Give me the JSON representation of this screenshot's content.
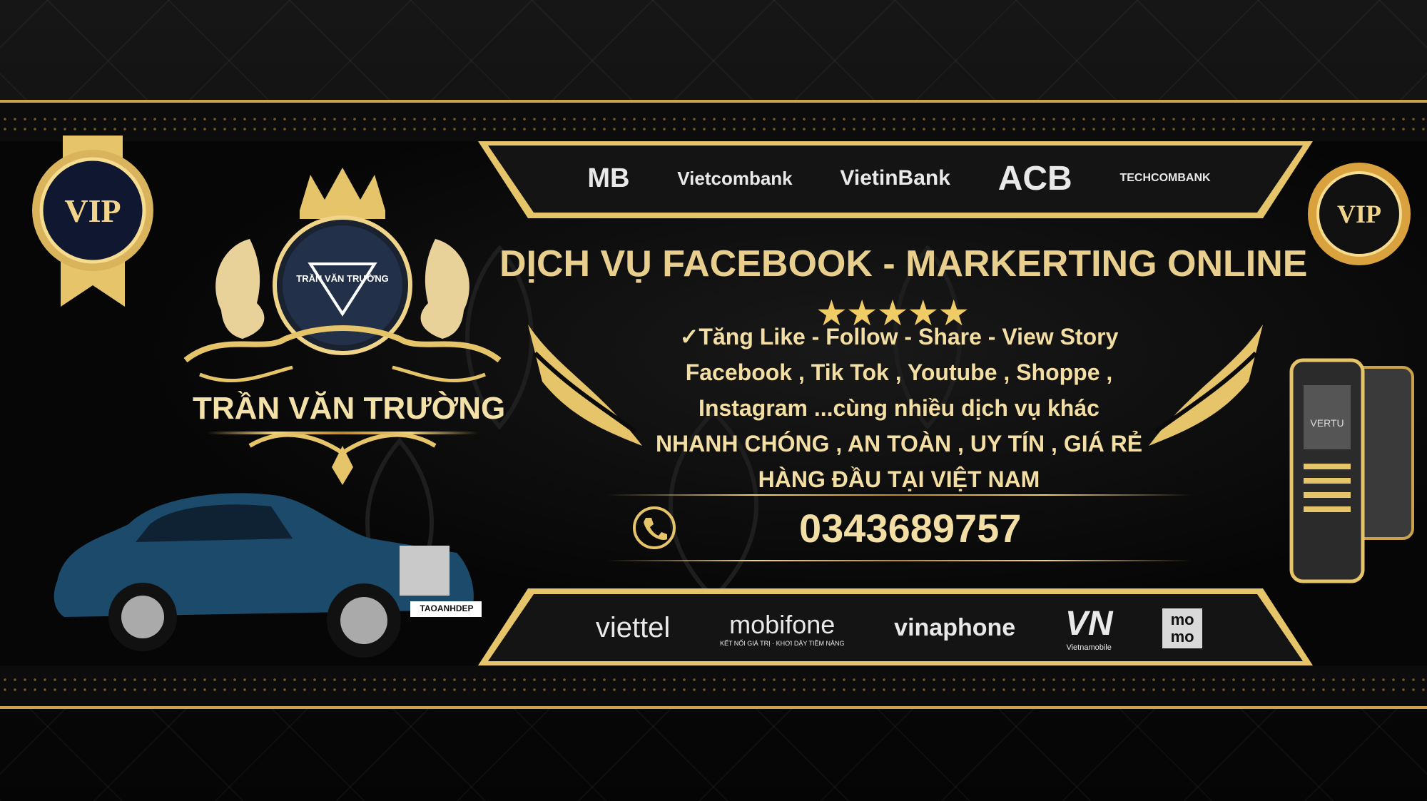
{
  "banks": [
    "MB",
    "Vietcombank",
    "VietinBank",
    "ACB",
    "TECHCOMBANK"
  ],
  "telcos": [
    "viettel",
    "mobifone",
    "vinaphone",
    "Vietnamobile",
    "mo mo"
  ],
  "mobifone_tagline": "KẾT NỐI GIÁ TRỊ · KHƠI DẬY TIỀM NĂNG",
  "vip_label": "VIP",
  "brand": {
    "name": "TRẦN VĂN TRƯỜNG",
    "avatar_text": "TRẦN VĂN TRƯỜNG"
  },
  "headline": "DỊCH VỤ FACEBOOK - MARKERTING ONLINE",
  "rating_stars": 5,
  "stars_text": "★★★★★",
  "services": [
    "✓Tăng Like - Follow - Share - View Story",
    "Facebook , Tik Tok , Youtube , Shoppe ,",
    "Instagram ...cùng nhiều dịch vụ khác",
    "NHANH CHÓNG , AN TOÀN , UY TÍN , GIÁ RẺ",
    "HÀNG ĐẦU TẠI VIỆT NAM"
  ],
  "phone": "0343689757",
  "car_plate": "TAOANHDEP",
  "phone_brand": "VERTU",
  "colors": {
    "gold": "#e8cf8e",
    "dark": "#060606"
  }
}
